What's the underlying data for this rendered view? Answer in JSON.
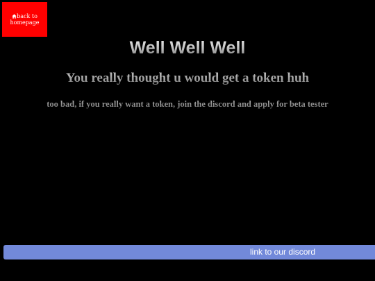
{
  "home_button": {
    "icon": "home-icon",
    "label": "back to homepage",
    "bg_color": "#ff0000"
  },
  "heading": {
    "title": "Well Well Well",
    "subtitle": "You really thought u would get a token huh",
    "message": "too bad, if you really want a token, join the discord and apply for beta tester"
  },
  "discord_link": {
    "label": "link to our discord",
    "bg_color": "#7289da"
  }
}
